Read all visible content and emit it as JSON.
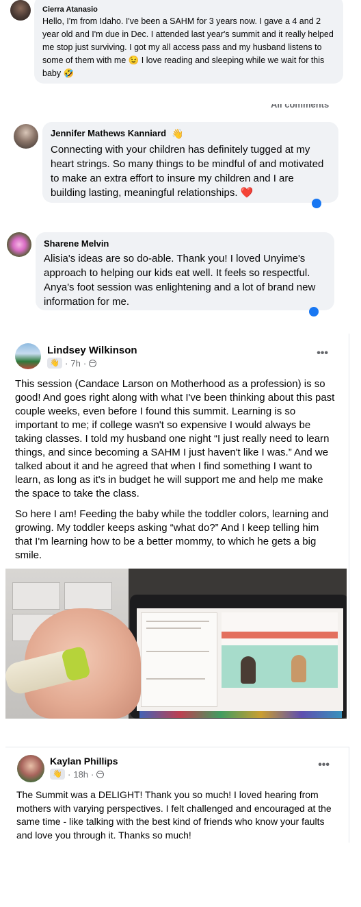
{
  "comments": [
    {
      "name": "Cierra Atanasio",
      "text": "Hello, I'm from Idaho. I've been a SAHM for 3 years now. I gave a 4 and 2 year old and I'm due in Dec. I attended last year's summit and it really helped me stop just surviving. I got my all access pass and my husband listens to some of them with me 😉 I love reading and sleeping while we wait for this baby 🤣"
    },
    {
      "name": "Jennifer Mathews Kanniard",
      "badge_icon": "waving-hand-icon",
      "text": "Connecting with your children has definitely tugged at my heart strings. So many things to be mindful of and motivated to make an extra effort to insure my children and I are building lasting, meaningful relationships. ❤️"
    },
    {
      "name": "Sharene Melvin",
      "text": "Alisia's ideas are so do-able. Thank you! I loved Unyime's approach to helping our kids eat well. It feels so respectful. Anya's foot session was enlightening and a lot of brand new information for me."
    }
  ],
  "all_comments_label": "All comments",
  "posts": [
    {
      "name": "Lindsey Wilkinson",
      "badge": "👋",
      "time": "7h",
      "paragraphs": [
        "This session (Candace Larson on Motherhood as a profession) is so good! And goes right along with what I've been thinking about this past couple weeks, even before I found this summit. Learning is so important to me; if college wasn't so expensive I would always be taking classes. I told my husband one night “I just really need to learn things, and since becoming a SAHM I just haven't like I was.” And we talked about it and he agreed that when I find something I want to learn, as long as it's in budget he will support me and help me make the space to take the class.",
        "So here I am! Feeding the baby while the toddler colors, learning and growing. My toddler keeps asking “what do?” And I keep telling him that I'm learning how to be a better mommy, to which he gets a big smile."
      ],
      "more": "•••"
    },
    {
      "name": "Kaylan Phillips",
      "badge": "👋",
      "time": "18h",
      "text": "The Summit was a DELIGHT! Thank you so much! I loved hearing from mothers with varying perspectives. I felt challenged and encouraged at the same time - like talking with the best kind of friends who know your faults and love you through it. Thanks so much!",
      "more": "•••"
    }
  ],
  "separator": "·",
  "colors": {
    "bubble": "#f0f2f5",
    "meta": "#65676b",
    "reaction": "#1877f2"
  }
}
